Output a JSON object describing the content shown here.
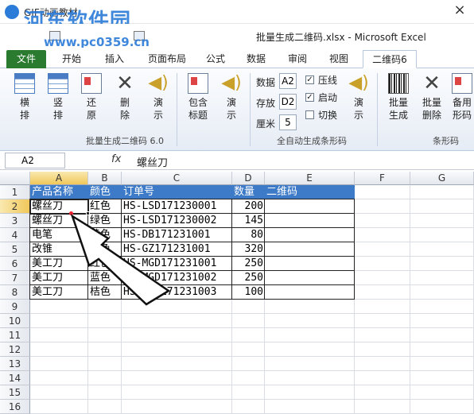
{
  "gif_window": {
    "title": "GIF动画教材",
    "close": "×"
  },
  "watermark": {
    "line1": "河东软件园",
    "line2": "www.pc0359.cn"
  },
  "excel": {
    "window_title": "批量生成二维码.xlsx - Microsoft Excel",
    "tabs": [
      "文件",
      "开始",
      "插入",
      "页面布局",
      "公式",
      "数据",
      "审阅",
      "视图",
      "二维码6"
    ],
    "active_tab": "二维码6"
  },
  "ribbon": {
    "buttons": [
      {
        "label1": "横",
        "label2": "排",
        "icon": "grid-horizontal-icon"
      },
      {
        "label1": "竖",
        "label2": "排",
        "icon": "grid-vertical-icon"
      },
      {
        "label1": "还",
        "label2": "原",
        "icon": "card-icon"
      },
      {
        "label1": "删",
        "label2": "除",
        "icon": "delete-x-icon"
      },
      {
        "label1": "演",
        "label2": "示",
        "icon": "speaker-icon"
      },
      {
        "label1": "包含",
        "label2": "标题",
        "icon": "card-icon"
      },
      {
        "label1": "演",
        "label2": "示",
        "icon": "speaker-icon"
      }
    ],
    "group1_label": "批量生成二维码 6.0",
    "settings": {
      "data_label": "数据",
      "data_value": "A2",
      "store_label": "存放",
      "store_value": "D2",
      "cm_label": "厘米",
      "cm_value": "5",
      "checks": [
        {
          "label": "压线",
          "checked": true
        },
        {
          "label": "启动",
          "checked": true
        },
        {
          "label": "切换",
          "checked": false
        }
      ],
      "demo_label1": "演",
      "demo_label2": "示"
    },
    "group2_label": "全自动生成条形码",
    "barcode_buttons": [
      {
        "label1": "批量",
        "label2": "生成",
        "icon": "barcode-icon"
      },
      {
        "label1": "批量",
        "label2": "删除",
        "icon": "delete-x-icon"
      },
      {
        "label1": "备用",
        "label2": "形码",
        "icon": "card-icon"
      }
    ],
    "group3_label": "条形码"
  },
  "formula_bar": {
    "name_box": "A2",
    "fx": "fx",
    "value": "螺丝刀"
  },
  "sheet": {
    "columns": [
      "A",
      "B",
      "C",
      "D",
      "E",
      "F",
      "G"
    ],
    "rows": [
      "1",
      "2",
      "3",
      "4",
      "5",
      "6",
      "7",
      "8",
      "9",
      "10",
      "11",
      "12",
      "13",
      "14",
      "15",
      "16"
    ],
    "header": [
      "产品名称",
      "颜色",
      "订单号",
      "数量",
      "二维码"
    ],
    "data": [
      [
        "螺丝刀",
        "红色",
        "HS-LSD171230001",
        "200"
      ],
      [
        "螺丝刀",
        "绿色",
        "HS-LSD171230002",
        "145"
      ],
      [
        "电笔",
        "黄色",
        "HS-DB171231001",
        "80"
      ],
      [
        "改锥",
        "绿色",
        "HS-GZ171231001",
        "320"
      ],
      [
        "美工刀",
        "红色",
        "HS-MGD171231001",
        "250"
      ],
      [
        "美工刀",
        "蓝色",
        "HS-MGD171231002",
        "250"
      ],
      [
        "美工刀",
        "桔色",
        "HS-MGD171231003",
        "100"
      ]
    ]
  },
  "colors": {
    "header_fill": "#3d7ac7",
    "file_tab": "#2a7a2f",
    "selection": "#f0c85a"
  }
}
